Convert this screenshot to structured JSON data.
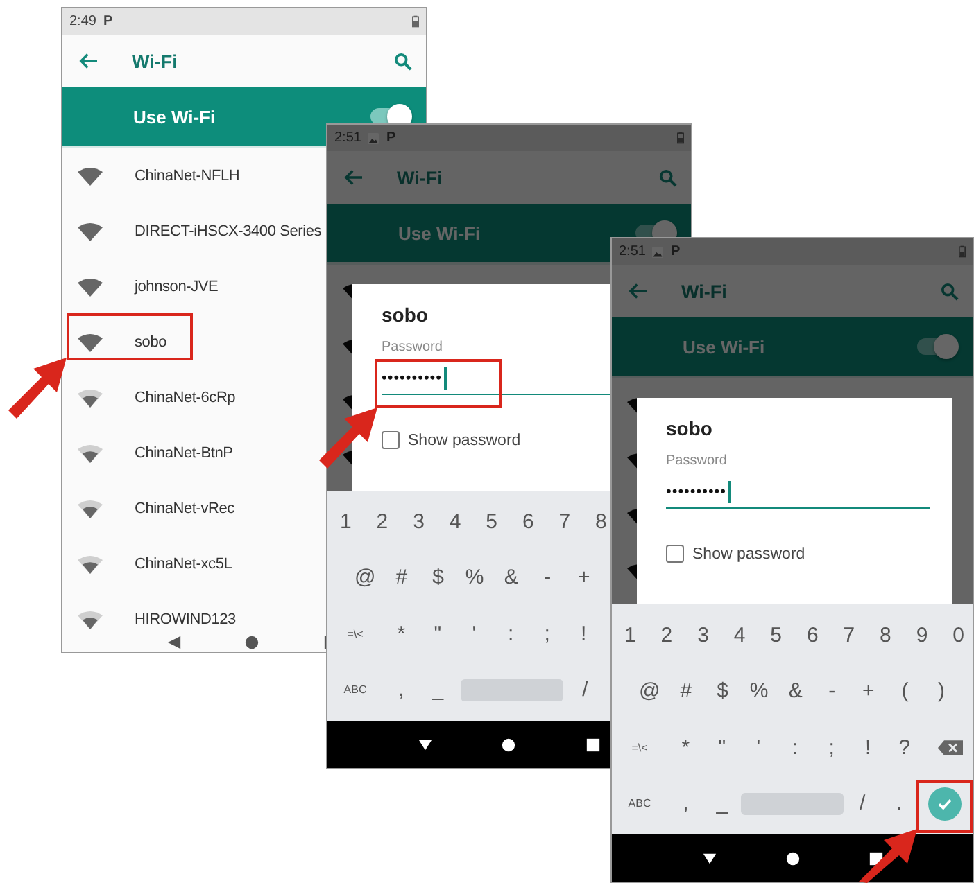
{
  "screens": [
    {
      "status_time": "2:49",
      "status_letter": "P",
      "show_image_icon": false,
      "toolbar_title": "Wi-Fi",
      "switch_label": "Use Wi-Fi",
      "switch_on": true,
      "dimmed": false,
      "networks": [
        {
          "name": "ChinaNet-NFLH",
          "weak": false
        },
        {
          "name": "DIRECT-iHSCX-3400 Series",
          "weak": false
        },
        {
          "name": "johnson-JVE",
          "weak": false
        },
        {
          "name": "sobo",
          "weak": false
        },
        {
          "name": "ChinaNet-6cRp",
          "weak": true
        },
        {
          "name": "ChinaNet-BtnP",
          "weak": true
        },
        {
          "name": "ChinaNet-vRec",
          "weak": true
        },
        {
          "name": "ChinaNet-xc5L",
          "weak": true
        },
        {
          "name": "HIROWIND123",
          "weak": true
        }
      ]
    },
    {
      "status_time": "2:51",
      "status_letter": "P",
      "show_image_icon": true,
      "toolbar_title": "Wi-Fi",
      "switch_label": "Use Wi-Fi",
      "switch_on": true,
      "dimmed": true,
      "dialog": {
        "title": "sobo",
        "label": "Password",
        "value": "••••••••••",
        "checkbox_label": "Show password",
        "checked": false
      },
      "keyboard": [
        [
          {
            "kind": "char",
            "text": "1"
          },
          {
            "kind": "char",
            "text": "2"
          },
          {
            "kind": "char",
            "text": "3"
          },
          {
            "kind": "char",
            "text": "4"
          },
          {
            "kind": "char",
            "text": "5"
          },
          {
            "kind": "char",
            "text": "6"
          },
          {
            "kind": "char",
            "text": "7"
          },
          {
            "kind": "char",
            "text": "8"
          }
        ],
        [
          {
            "kind": "char",
            "text": "@"
          },
          {
            "kind": "char",
            "text": "#"
          },
          {
            "kind": "char",
            "text": "$"
          },
          {
            "kind": "char",
            "text": "%"
          },
          {
            "kind": "char",
            "text": "&"
          },
          {
            "kind": "char",
            "text": "-"
          },
          {
            "kind": "char",
            "text": "+"
          }
        ],
        [
          {
            "kind": "small",
            "text": "=\\<"
          },
          {
            "kind": "char",
            "text": "*"
          },
          {
            "kind": "char",
            "text": "\""
          },
          {
            "kind": "char",
            "text": "'"
          },
          {
            "kind": "char",
            "text": ":"
          },
          {
            "kind": "char",
            "text": ";"
          },
          {
            "kind": "char",
            "text": "!"
          }
        ],
        [
          {
            "kind": "small",
            "text": "ABC"
          },
          {
            "kind": "char",
            "text": ","
          },
          {
            "kind": "char",
            "text": "_"
          },
          {
            "kind": "space"
          },
          {
            "kind": "char",
            "text": "/"
          }
        ]
      ]
    },
    {
      "status_time": "2:51",
      "status_letter": "P",
      "show_image_icon": true,
      "toolbar_title": "Wi-Fi",
      "switch_label": "Use Wi-Fi",
      "switch_on": true,
      "dimmed": true,
      "dialog": {
        "title": "sobo",
        "label": "Password",
        "value": "••••••••••",
        "checkbox_label": "Show password",
        "checked": false
      },
      "keyboard": [
        [
          {
            "kind": "char",
            "text": "1"
          },
          {
            "kind": "char",
            "text": "2"
          },
          {
            "kind": "char",
            "text": "3"
          },
          {
            "kind": "char",
            "text": "4"
          },
          {
            "kind": "char",
            "text": "5"
          },
          {
            "kind": "char",
            "text": "6"
          },
          {
            "kind": "char",
            "text": "7"
          },
          {
            "kind": "char",
            "text": "8"
          },
          {
            "kind": "char",
            "text": "9"
          },
          {
            "kind": "char",
            "text": "0"
          }
        ],
        [
          {
            "kind": "char",
            "text": "@"
          },
          {
            "kind": "char",
            "text": "#"
          },
          {
            "kind": "char",
            "text": "$"
          },
          {
            "kind": "char",
            "text": "%"
          },
          {
            "kind": "char",
            "text": "&"
          },
          {
            "kind": "char",
            "text": "-"
          },
          {
            "kind": "char",
            "text": "+"
          },
          {
            "kind": "char",
            "text": "("
          },
          {
            "kind": "char",
            "text": ")"
          }
        ],
        [
          {
            "kind": "small",
            "text": "=\\<"
          },
          {
            "kind": "char",
            "text": "*"
          },
          {
            "kind": "char",
            "text": "\""
          },
          {
            "kind": "char",
            "text": "'"
          },
          {
            "kind": "char",
            "text": ":"
          },
          {
            "kind": "char",
            "text": ";"
          },
          {
            "kind": "char",
            "text": "!"
          },
          {
            "kind": "char",
            "text": "?"
          },
          {
            "kind": "backspace"
          }
        ],
        [
          {
            "kind": "small",
            "text": "ABC"
          },
          {
            "kind": "char",
            "text": ","
          },
          {
            "kind": "char",
            "text": "_"
          },
          {
            "kind": "space"
          },
          {
            "kind": "char",
            "text": "/"
          },
          {
            "kind": "char",
            "text": "."
          },
          {
            "kind": "done"
          }
        ]
      ]
    }
  ]
}
